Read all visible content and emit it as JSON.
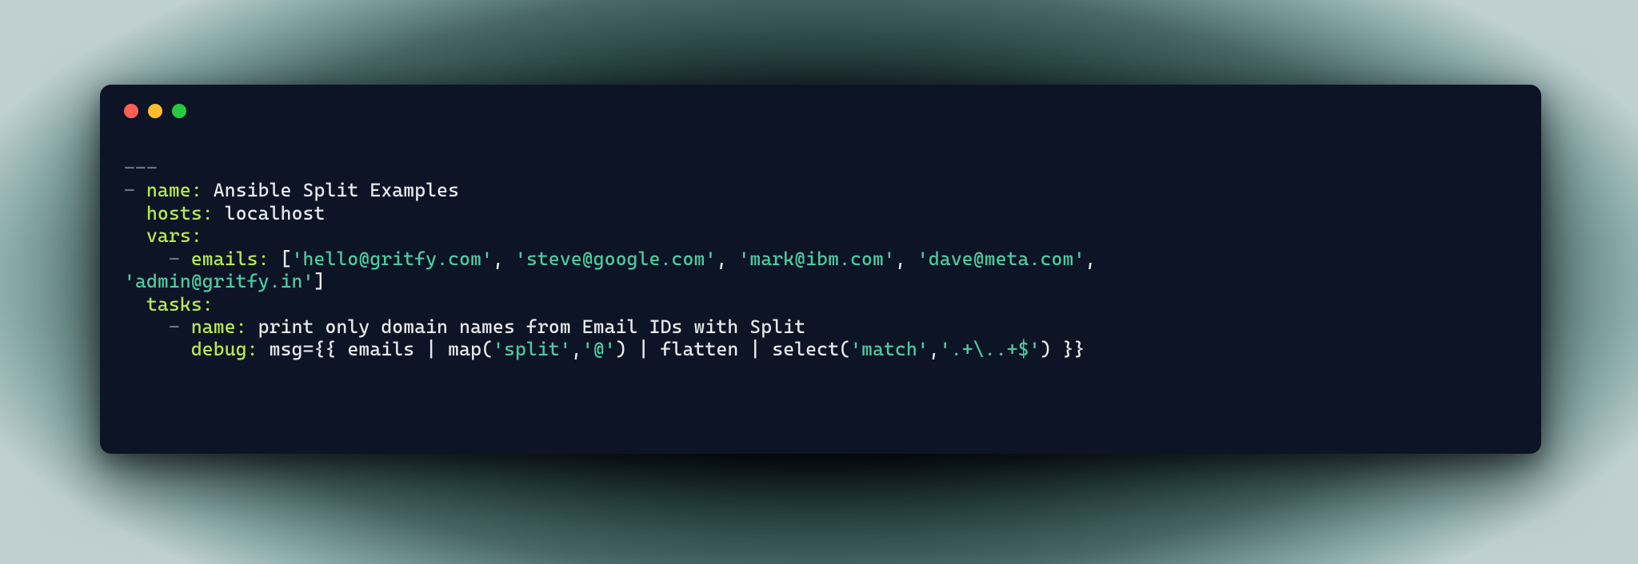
{
  "code": {
    "dashes": "---",
    "dash": "- ",
    "indent1": "  ",
    "indent2": "    ",
    "indent2dash": "    - ",
    "indent3": "      ",
    "k_name": "name:",
    "v_name1": " Ansible Split Examples",
    "k_hosts": "hosts:",
    "v_hosts": " localhost",
    "k_vars": "vars:",
    "k_emails": "emails:",
    "emails_open": " [",
    "e1": "'hello@gritfy.com'",
    "e2": "'steve@google.com'",
    "e3": "'mark@ibm.com'",
    "e4": "'dave@meta.com'",
    "e5": "'admin@gritfy.in'",
    "comma": ", ",
    "emails_close": "]",
    "k_tasks": "tasks:",
    "v_name2": " print only domain names from Email IDs with Split",
    "k_debug": "debug:",
    "msg_eq": " msg=",
    "open_brace": "{{ ",
    "emails_var": "emails",
    "pipe_map": " | map(",
    "s_split": "'split'",
    "s_at": "'@'",
    "close_paren": ")",
    "pipe_flatten": " | flatten | select(",
    "s_match": "'match'",
    "s_regex": "'.+\\..+$'",
    "close_brace": " }}",
    "comma2": ","
  }
}
